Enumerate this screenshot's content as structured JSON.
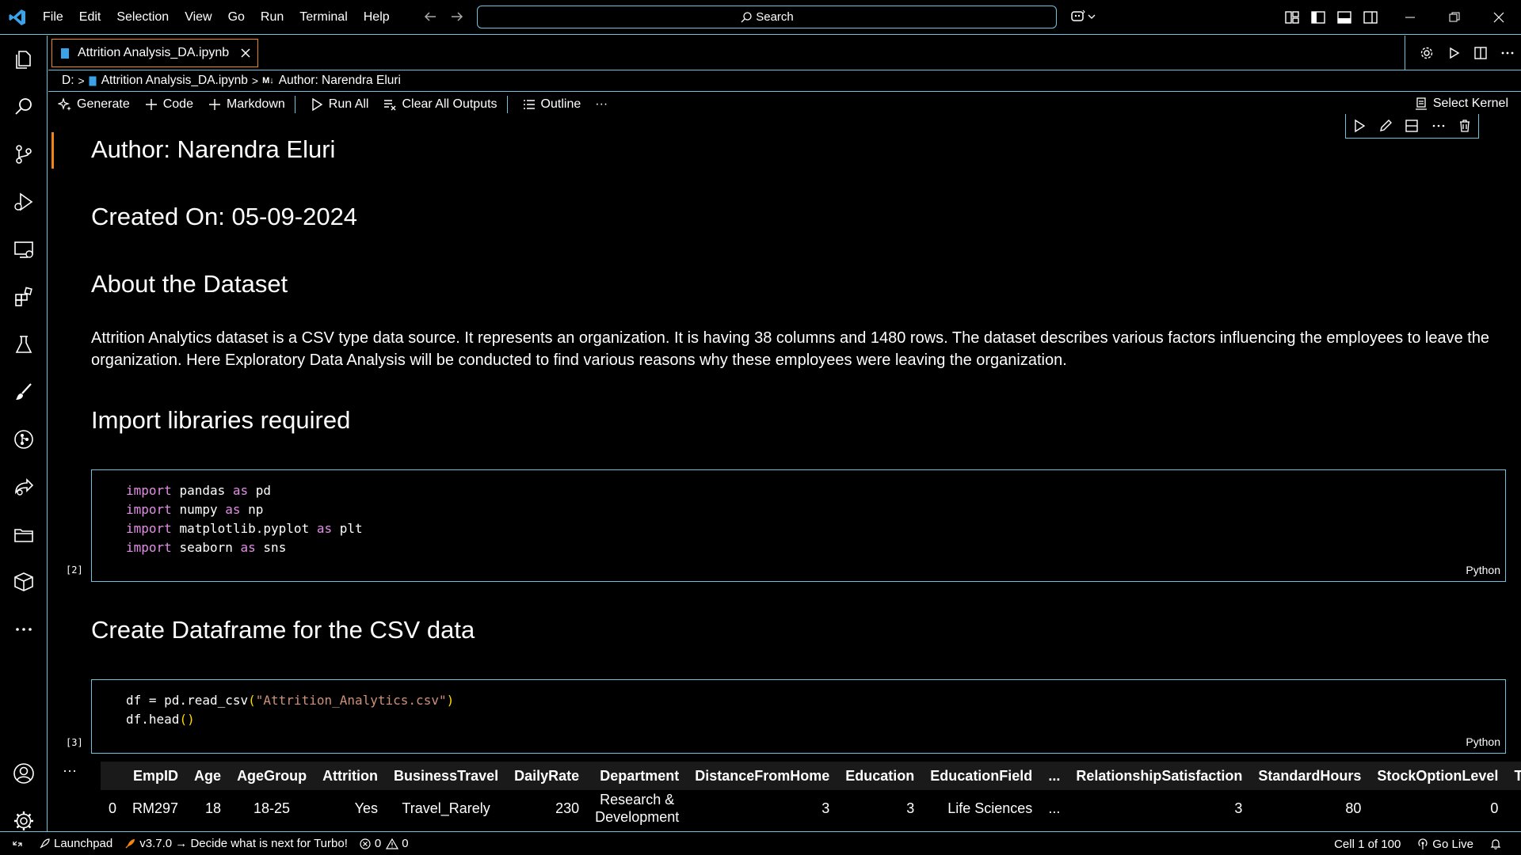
{
  "menu": [
    "File",
    "Edit",
    "Selection",
    "View",
    "Go",
    "Run",
    "Terminal",
    "Help"
  ],
  "search": {
    "label": "Search"
  },
  "tab": {
    "title": "Attrition Analysis_DA.ipynb"
  },
  "breadcrumb": {
    "drive": "D:",
    "file": "Attrition Analysis_DA.ipynb",
    "md_badge": "M↓",
    "cell": "Author: Narendra Eluri"
  },
  "toolbar": {
    "generate": "Generate",
    "code": "Code",
    "markdown": "Markdown",
    "run_all": "Run All",
    "clear_outputs": "Clear All Outputs",
    "outline": "Outline",
    "more": "···",
    "select_kernel": "Select Kernel"
  },
  "cells": {
    "author": "Author: Narendra Eluri",
    "created": "Created On: 05-09-2024",
    "about_heading": "About the Dataset",
    "about_text": "Attrition Analytics dataset is a CSV type data source. It represents an organization. It is having 38 columns and 1480 rows. The dataset describes various factors influencing the employees to leave the organization. Here Exploratory Data Analysis will be conducted to find various reasons why these employees were leaving the organization.",
    "import_heading": "Import libraries required",
    "import_lines": [
      {
        "kw": "import",
        "mod": "pandas",
        "as": "as",
        "alias": "pd"
      },
      {
        "kw": "import",
        "mod": "numpy",
        "as": "as",
        "alias": "np"
      },
      {
        "kw": "import",
        "mod": "matplotlib.pyplot",
        "as": "as",
        "alias": "plt"
      },
      {
        "kw": "import",
        "mod": "seaborn",
        "as": "as",
        "alias": "sns"
      }
    ],
    "import_count": "[2]",
    "lang": "Python",
    "dataframe_heading": "Create Dataframe for the CSV data",
    "df_line1_pre": "df = pd.read_csv",
    "df_line1_open": "(",
    "df_line1_str": "\"Attrition_Analytics.csv\"",
    "df_line1_close": ")",
    "df_line2_pre": "df.head",
    "df_line2_parens": "()",
    "df_count": "[3]",
    "output_more": "···"
  },
  "output_table": {
    "columns": [
      "",
      "EmpID",
      "Age",
      "AgeGroup",
      "Attrition",
      "BusinessTravel",
      "DailyRate",
      "Department",
      "DistanceFromHome",
      "Education",
      "EducationField",
      "...",
      "RelationshipSatisfaction",
      "StandardHours",
      "StockOptionLevel",
      "TotalW"
    ],
    "rows": [
      [
        "0",
        "RM297",
        "18",
        "18-25",
        "Yes",
        "Travel_Rarely",
        "230",
        "Research & Development",
        "3",
        "3",
        "Life Sciences",
        "...",
        "3",
        "80",
        "0",
        ""
      ]
    ]
  },
  "status": {
    "launchpad": "Launchpad",
    "turbo": "v3.7.0 → Decide what is next for Turbo!",
    "errors": "0",
    "warnings": "0",
    "cell_pos": "Cell 1 of 100",
    "go_live": "Go Live"
  }
}
